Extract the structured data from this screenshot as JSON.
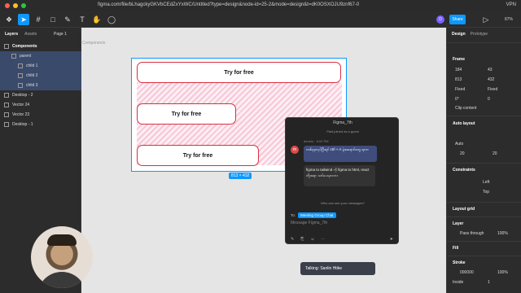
{
  "menubar": {
    "url": "figma.com/file/bLhagckyGKVbCEdZxYxWC/Untitled?type=design&node-id=25-2&mode=design&t=dK0OSXOJU9znf67-0",
    "vpn": "VPN"
  },
  "toolbar": {
    "share_label": "Share",
    "zoom": "87%",
    "user_initial": "D"
  },
  "left_panel": {
    "tabs": [
      "Layers",
      "Assets"
    ],
    "page": "Page 1",
    "section": "Components",
    "layers": [
      {
        "label": "parent"
      },
      {
        "label": "child 1"
      },
      {
        "label": "child 2"
      },
      {
        "label": "child 3"
      },
      {
        "label": "Desktop - 2"
      },
      {
        "label": "Vector 24"
      },
      {
        "label": "Vector 23"
      },
      {
        "label": "Desktop - 1"
      }
    ]
  },
  "canvas": {
    "components_label": "Components",
    "buttons": [
      "Try for free",
      "Try for free",
      "Try for free"
    ],
    "dimension_badge": "813 × 432"
  },
  "chat": {
    "title": "Figma_7th",
    "joined_text": "Paid joined as a guest",
    "sender_initial": "m",
    "sender_name": "denelo",
    "time": "6:02 PM",
    "message1": "တစ်ခုခုလုပ်ပြီးရင် ctrl + A နဲ့အရောင်တွေ ရလာ",
    "message2": "figma to tailwind ကို figma to html, react တို့အရာ သင်ပေးမှာလား",
    "who_can_see": "Who can see your messages?",
    "to_label": "To:",
    "to_chip": "Meeting Group Chat",
    "input_placeholder": "Message Figma_7th"
  },
  "talking": {
    "text": "Talking: Sanlin Htike"
  },
  "right_panel": {
    "tabs": [
      "Design",
      "Prototype"
    ],
    "frame_title": "Frame",
    "x": "184",
    "y": "43",
    "w": "813",
    "h": "432",
    "fixed_w": "Fixed",
    "fixed_h": "Fixed",
    "rotation": "0°",
    "radius": "0",
    "clip_content": "Clip content",
    "auto_layout": "Auto layout",
    "auto": "Auto",
    "gap": "20",
    "padding": "20",
    "constraints": "Constraints",
    "constraint_h": "Left",
    "constraint_v": "Top",
    "layout_grid": "Layout grid",
    "layer": "Layer",
    "pass_through": "Pass through",
    "layer_opacity": "100%",
    "fill": "Fill",
    "stroke": "Stroke",
    "stroke_color": "000000",
    "stroke_opacity": "100%",
    "stroke_position": "Inside",
    "stroke_width": "1"
  },
  "colors": {
    "accent": "#0d99ff",
    "button_border": "#d93042",
    "bubble": "#3f4d7d"
  }
}
